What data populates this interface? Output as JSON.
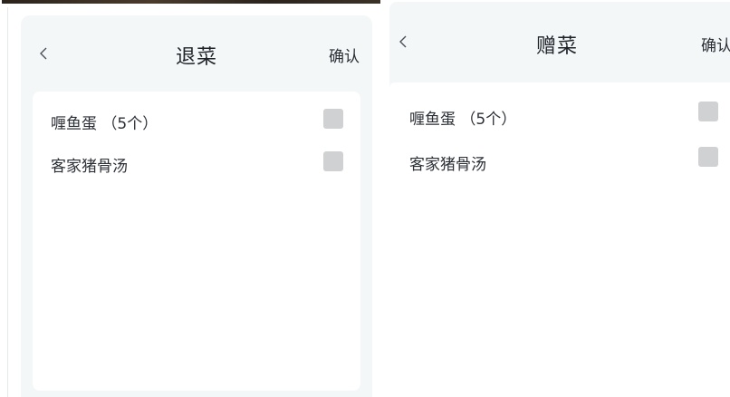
{
  "return_dialog": {
    "back_icon": "chevron-left-icon",
    "title": "退菜",
    "confirm_label": "确认",
    "items": [
      {
        "label": "喱鱼蛋 （5个）",
        "checked": false
      },
      {
        "label": "客家猪骨汤",
        "checked": false
      }
    ]
  },
  "gift_dialog": {
    "back_icon": "chevron-left-icon",
    "title": "赠菜",
    "confirm_label": "确认",
    "items": [
      {
        "label": "喱鱼蛋 （5个）",
        "checked": false
      },
      {
        "label": "客家猪骨汤",
        "checked": false
      }
    ]
  },
  "colors": {
    "dialog_bg": "#f4f7f8",
    "panel_bg": "#ffffff",
    "checkbox_unchecked": "#cfd1d3",
    "text": "#2b2f36"
  }
}
